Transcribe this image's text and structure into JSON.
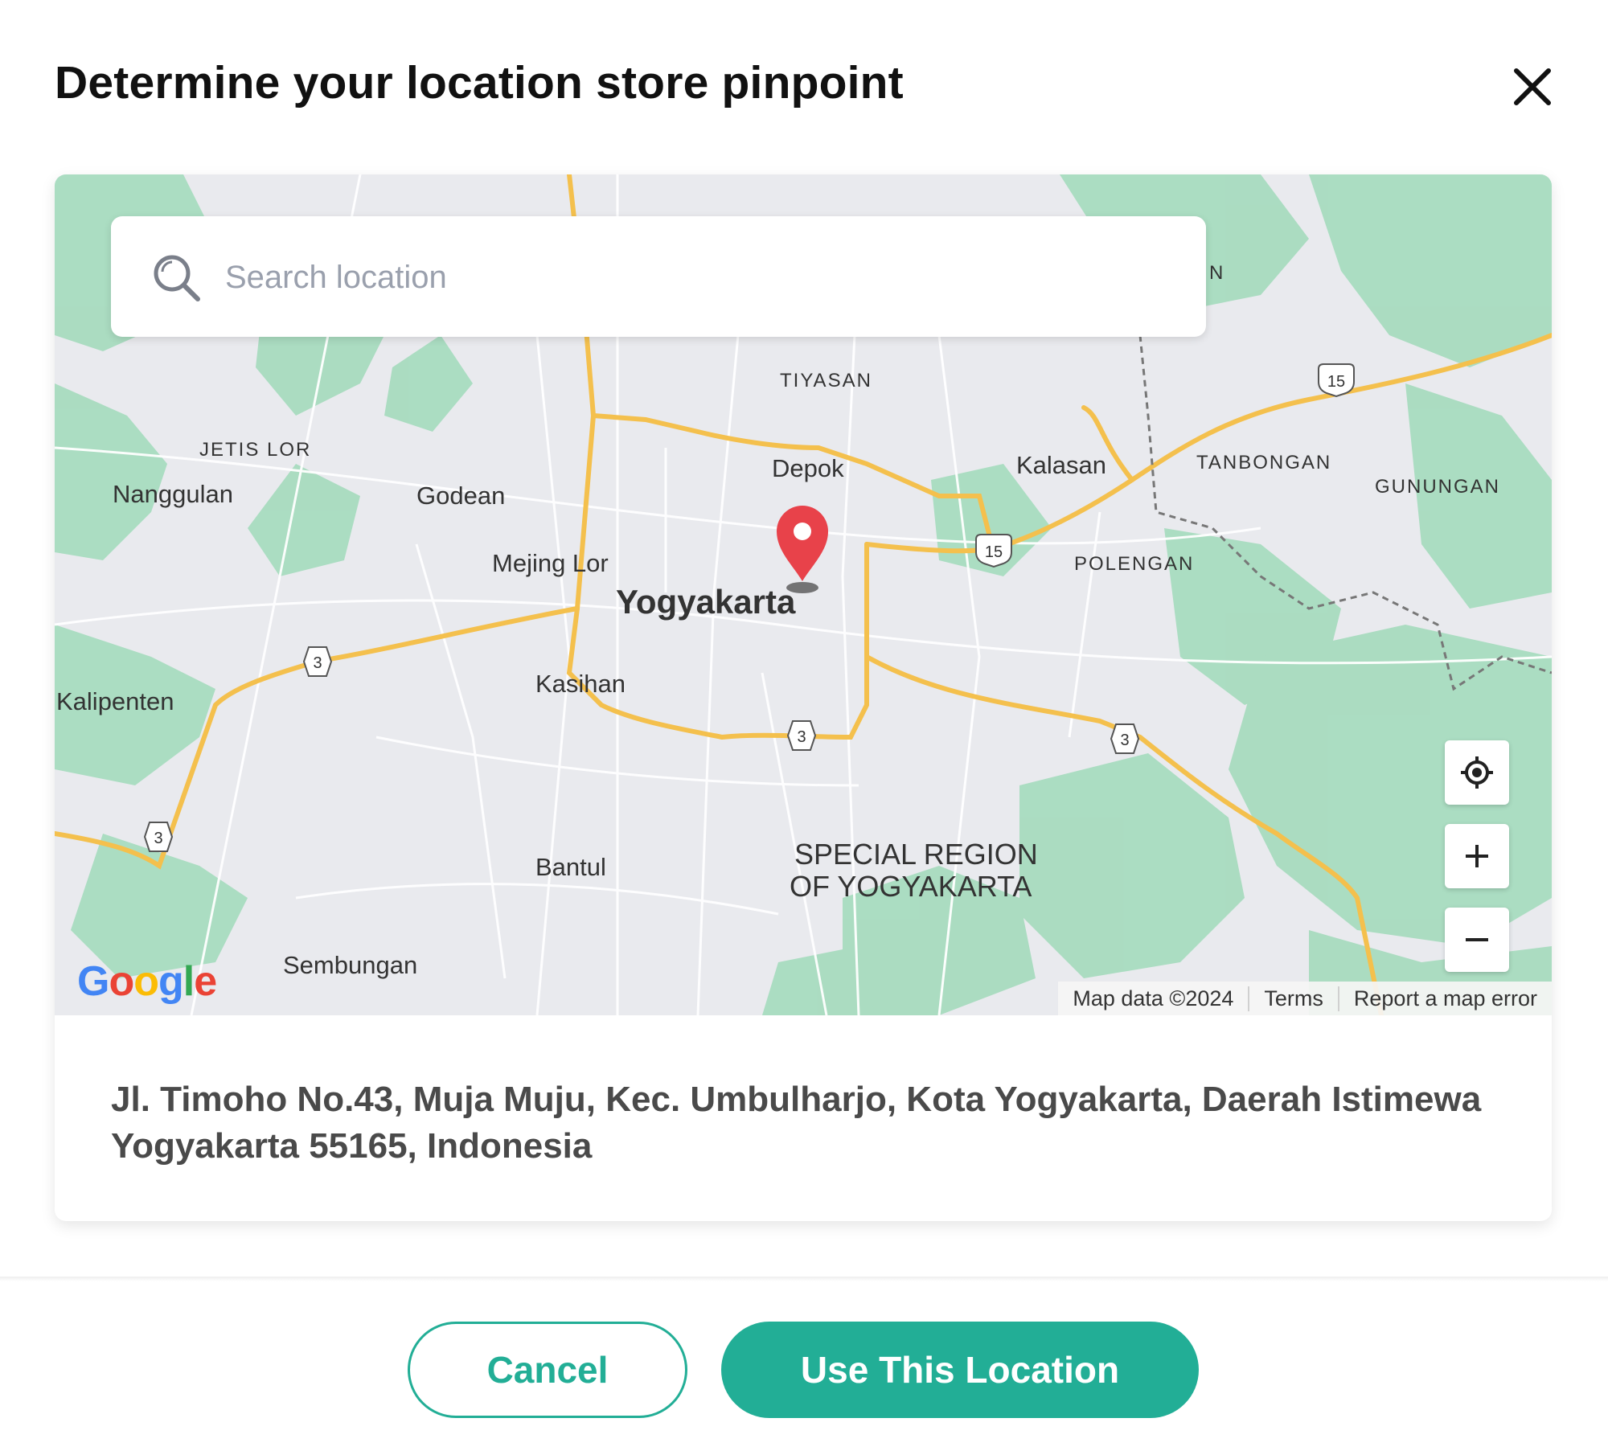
{
  "dialog": {
    "title": "Determine your location store pinpoint"
  },
  "search": {
    "placeholder": "Search location"
  },
  "map": {
    "labels": {
      "jetis_lor": "JETIS LOR",
      "nanggulan": "Nanggulan",
      "godean": "Godean",
      "tiyasan": "TIYASAN",
      "depok": "Depok",
      "kalasan": "Kalasan",
      "tanbongan": "TANBONGAN",
      "gunungan": "GUNUNGAN",
      "polengan": "POLENGAN",
      "mejing_lor": "Mejing Lor",
      "yogyakarta": "Yogyakarta",
      "kasihan": "Kasihan",
      "kalipenten": "Kalipenten",
      "bantul": "Bantul",
      "special_region_1": "SPECIAL REGION",
      "special_region_2": "OF YOGYAKARTA",
      "sembungan": "Sembungan",
      "partial_n": "N"
    },
    "route_shields": [
      "15",
      "15",
      "3",
      "3",
      "3",
      "3"
    ],
    "google_logo": "Google",
    "footer": {
      "map_data": "Map data ©2024",
      "terms": "Terms",
      "report": "Report a map error"
    },
    "icons": {
      "pin": "map-pin-icon",
      "locate": "my-location-icon",
      "zoom_in": "plus-icon",
      "zoom_out": "minus-icon"
    },
    "colors": {
      "land": "#e9eaee",
      "green": "#a8dcbf",
      "highway": "#f4c04d",
      "pin": "#e8424a"
    }
  },
  "address": {
    "text": "Jl. Timoho No.43, Muja Muju, Kec. Umbulharjo, Kota Yogyakarta, Daerah Istimewa Yogyakarta 55165, Indonesia"
  },
  "actions": {
    "cancel": "Cancel",
    "use_location": "Use This Location",
    "accent_color": "#22ae96"
  }
}
